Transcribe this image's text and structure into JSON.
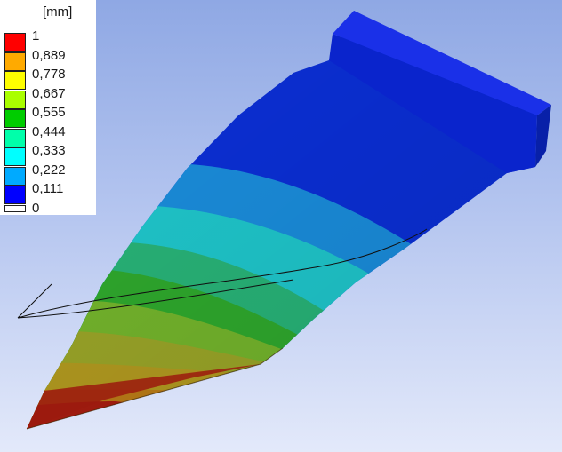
{
  "legend": {
    "unit": "[mm]",
    "bands": [
      {
        "color": "#ff0000"
      },
      {
        "color": "#ffaa00"
      },
      {
        "color": "#ffff00"
      },
      {
        "color": "#aaff00"
      },
      {
        "color": "#00cc00"
      },
      {
        "color": "#00ffaa"
      },
      {
        "color": "#00ffff"
      },
      {
        "color": "#00aaff"
      },
      {
        "color": "#0000ff"
      },
      {
        "color": "#ffffff"
      }
    ],
    "ticks": [
      "1",
      "0,889",
      "0,778",
      "0,667",
      "0,555",
      "0,444",
      "0,333",
      "0,222",
      "0,111",
      "0"
    ]
  },
  "model": {
    "band_colors": [
      "#0b2fd6",
      "#1a8ddc",
      "#1fc7cc",
      "#28b478",
      "#2fa92d",
      "#74b52c",
      "#9aa528",
      "#b29a20",
      "#bb7c18",
      "#a81d10"
    ]
  }
}
